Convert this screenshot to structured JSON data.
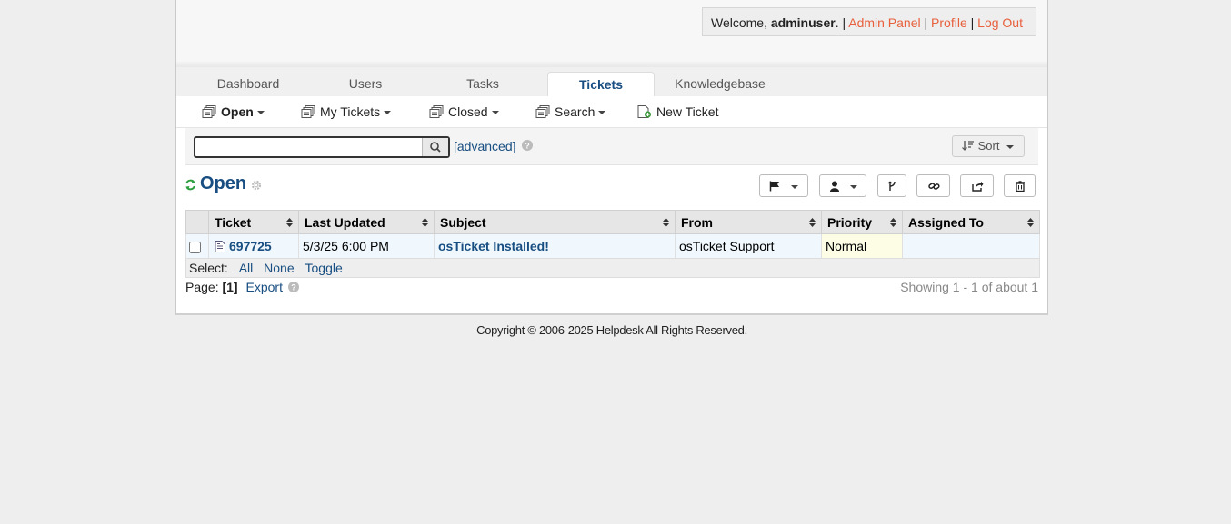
{
  "header": {
    "welcome_prefix": "Welcome, ",
    "username": "adminuser",
    "welcome_suffix": ". | ",
    "admin_panel": "Admin Panel",
    "sep1": " | ",
    "profile": "Profile",
    "sep2": " | ",
    "logout": "Log Out"
  },
  "nav": {
    "tabs": [
      {
        "label": "Dashboard"
      },
      {
        "label": "Users"
      },
      {
        "label": "Tasks"
      },
      {
        "label": "Tickets",
        "active": true
      },
      {
        "label": "Knowledgebase"
      }
    ]
  },
  "subnav": {
    "items": [
      {
        "label": "Open",
        "icon": "tickets-icon",
        "dropdown": true
      },
      {
        "label": "My Tickets",
        "icon": "tickets-icon",
        "dropdown": true
      },
      {
        "label": "Closed",
        "icon": "tickets-icon",
        "dropdown": true
      },
      {
        "label": "Search",
        "icon": "tickets-icon",
        "dropdown": true
      },
      {
        "label": "New Ticket",
        "icon": "new-ticket-icon",
        "dropdown": false
      }
    ]
  },
  "search": {
    "value": "",
    "advanced": "[advanced]",
    "sort_label": "Sort"
  },
  "page": {
    "title": "Open"
  },
  "table": {
    "headers": [
      "Ticket",
      "Last Updated",
      "Subject",
      "From",
      "Priority",
      "Assigned To"
    ],
    "rows": [
      {
        "ticket": "697725",
        "last_updated": "5/3/25 6:00 PM",
        "subject": "osTicket Installed!",
        "from": "osTicket Support",
        "priority": "Normal",
        "assigned_to": ""
      }
    ]
  },
  "select": {
    "label": "Select:",
    "all": "All",
    "none": "None",
    "toggle": "Toggle"
  },
  "pager": {
    "label": "Page:",
    "current": "[1]",
    "export": "Export",
    "showing": "Showing 1 - 1 of about 1"
  },
  "footer": {
    "copyright": "Copyright © 2006-2025 Helpdesk All Rights Reserved."
  },
  "colors": {
    "accent_blue": "#184e81",
    "link_orange": "#e8603c",
    "refresh_green": "#2e9e3e"
  }
}
